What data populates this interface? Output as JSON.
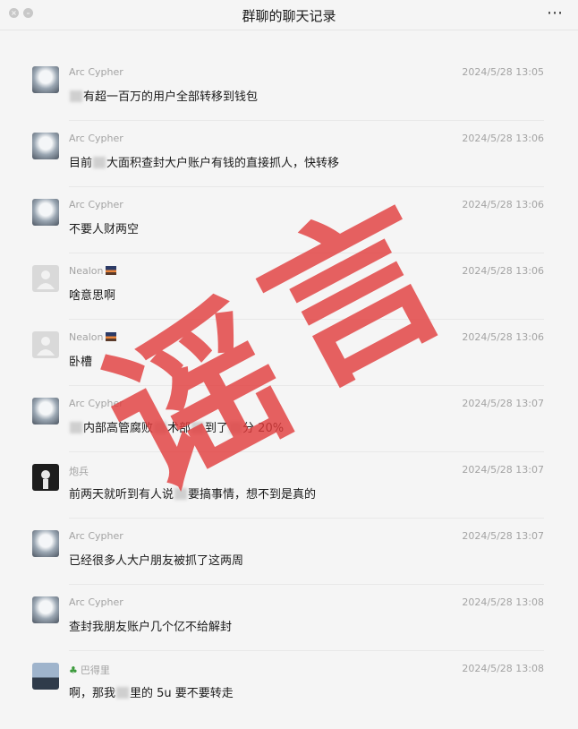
{
  "window": {
    "title": "群聊的聊天记录",
    "more_icon": "⋯",
    "close_icon": "×",
    "minimize_icon": "–"
  },
  "messages": [
    {
      "sender": "Arc Cypher",
      "time": "2024/5/28 13:05",
      "text_a": "",
      "text_b": "有超一百万的用户全部转移到钱包"
    },
    {
      "sender": "Arc Cypher",
      "time": "2024/5/28 13:06",
      "text_a": "目前",
      "text_b": "大面积查封大户账户有钱的直接抓人，快转移"
    },
    {
      "sender": "Arc Cypher",
      "time": "2024/5/28 13:06",
      "text_a": "不要人财两空",
      "text_b": ""
    },
    {
      "sender": "Nealon",
      "time": "2024/5/28 13:06",
      "text_a": "啥意思啊",
      "text_b": ""
    },
    {
      "sender": "Nealon",
      "time": "2024/5/28 13:06",
      "text_a": "卧槽",
      "text_b": ""
    },
    {
      "sender": "Arc Cypher",
      "time": "2024/5/28 13:07",
      "text_a": "",
      "text_b": "内部高管腐败",
      "text_c": "术部",
      "text_d": "到了",
      "text_e": "分 20%"
    },
    {
      "sender": "炮兵",
      "time": "2024/5/28 13:07",
      "text_a": "前两天就听到有人说",
      "text_b": "要搞事情，想不到是真的"
    },
    {
      "sender": "Arc Cypher",
      "time": "2024/5/28 13:07",
      "text_a": "已经很多人大户朋友被抓了这两周",
      "text_b": ""
    },
    {
      "sender": "Arc Cypher",
      "time": "2024/5/28 13:08",
      "text_a": "查封我朋友账户几个亿不给解封",
      "text_b": ""
    },
    {
      "sender": "巴得里",
      "time": "2024/5/28 13:08",
      "text_a": "啊，那我",
      "text_b": "里的 5u 要不要转走"
    }
  ],
  "stamp": {
    "char1": "谣",
    "char2": "言",
    "color": "#e23b3b"
  }
}
